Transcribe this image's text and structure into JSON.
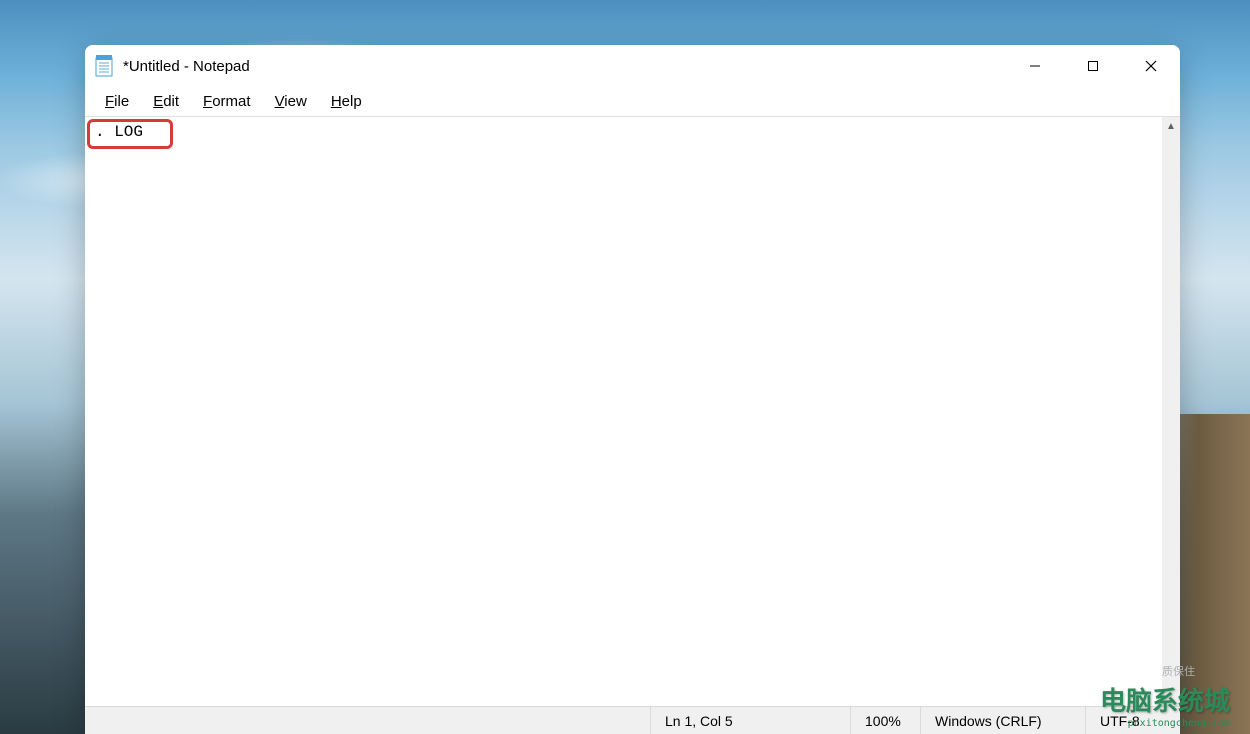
{
  "window": {
    "title": "*Untitled - Notepad"
  },
  "menu": {
    "file": "File",
    "edit": "Edit",
    "format": "Format",
    "view": "View",
    "help": "Help"
  },
  "editor": {
    "content": ". LOG"
  },
  "statusbar": {
    "position": "Ln 1, Col 5",
    "zoom": "100%",
    "eol": "Windows (CRLF)",
    "encoding": "UTF-8"
  },
  "watermark": {
    "main": "电脑系统城",
    "sub": "pcxitongcheng.com",
    "quality": "质保住"
  }
}
